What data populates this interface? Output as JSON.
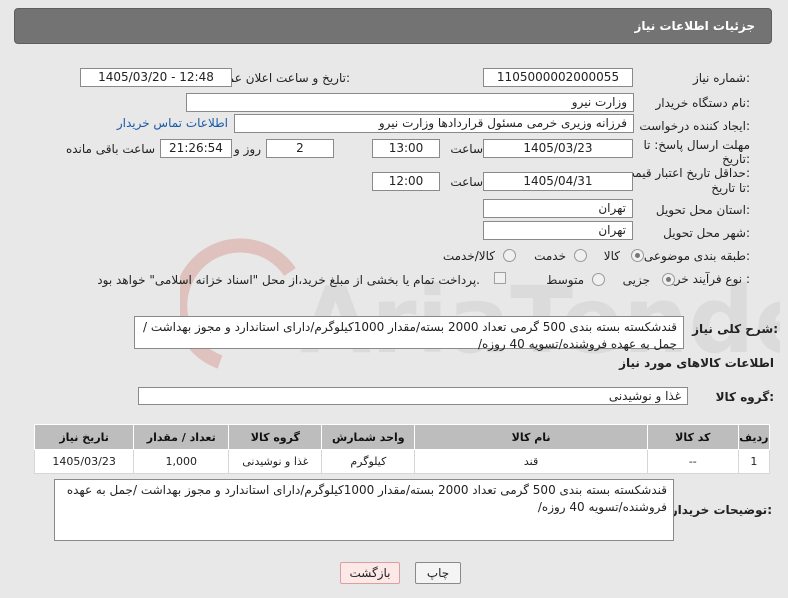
{
  "header": {
    "title": "جزئیات اطلاعات نیاز"
  },
  "form": {
    "need_number": {
      "label": "شماره نیاز:",
      "value": "1105000002000055"
    },
    "announce": {
      "label": "تاریخ و ساعت اعلان عمومی:",
      "value": "1405/03/20 - 12:48"
    },
    "buyer": {
      "label": "نام دستگاه خریدار:",
      "value": "وزارت نیرو"
    },
    "requester": {
      "label": "ایجاد کننده درخواست:",
      "value": "فرزانه وزیری خرمی مسئول قراردادها وزارت نیرو",
      "contact_link": "اطلاعات تماس خریدار"
    },
    "deadline": {
      "label_line1": "مهلت ارسال پاسخ: تا",
      "label_line2": "تاریخ:",
      "date": "1405/03/23",
      "time_label": "ساعت",
      "time": "13:00",
      "days": "2",
      "days_label": "روز و",
      "remaining": "21:26:54",
      "remaining_label": "ساعت باقی مانده"
    },
    "price_validity": {
      "label_line1": "حداقل تاریخ اعتبار قیمت:",
      "label_line2": "تا تاریخ:",
      "date": "1405/04/31",
      "time_label": "ساعت",
      "time": "12:00"
    },
    "delivery_province": {
      "label": "استان محل تحویل:",
      "value": "تهران"
    },
    "delivery_city": {
      "label": "شهر محل تحویل:",
      "value": "تهران"
    },
    "category": {
      "label": "طبقه بندی موضوعی:",
      "options": [
        "کالا",
        "خدمت",
        "کالا/خدمت"
      ],
      "selected": "کالا"
    },
    "process": {
      "label": "نوع فرآیند خرید :",
      "options": [
        "جزیی",
        "متوسط"
      ],
      "selected": "جزیی",
      "payment_note": "پرداخت تمام یا بخشی از مبلغ خرید،از محل \"اسناد خزانه اسلامی\" خواهد بود."
    }
  },
  "description": {
    "label": "شرح کلی نیاز:",
    "text": "قندشکسته بسته بندی 500 گرمی تعداد 2000 بسته/مقدار 1000کیلوگرم/دارای استاندارد و مجوز بهداشت / جمل به عهده فروشنده/تسویه 40 روزه/"
  },
  "goods": {
    "section_title": "اطلاعات کالاهای مورد نیاز",
    "group_label": "گروه کالا:",
    "group_value": "غذا و نوشیدنی",
    "columns": [
      "ردیف",
      "کد کالا",
      "نام کالا",
      "واحد شمارش",
      "گروه کالا",
      "تعداد / مقدار",
      "تاریخ نیاز"
    ],
    "rows": [
      [
        "1",
        "--",
        "قند",
        "کیلوگرم",
        "غذا و نوشیدنی",
        "1,000",
        "1405/03/23"
      ]
    ]
  },
  "buyer_notes": {
    "label": "توضیحات خریدار:",
    "text": "قندشکسته بسته بندی 500 گرمی تعداد 2000 بسته/مقدار 1000کیلوگرم/دارای استاندارد و مجوز بهداشت /جمل به عهده فروشنده/تسویه 40 روزه/"
  },
  "buttons": {
    "print": "چاپ",
    "back": "بازگشت"
  },
  "watermark": {
    "text": "AriaTender.neT"
  }
}
